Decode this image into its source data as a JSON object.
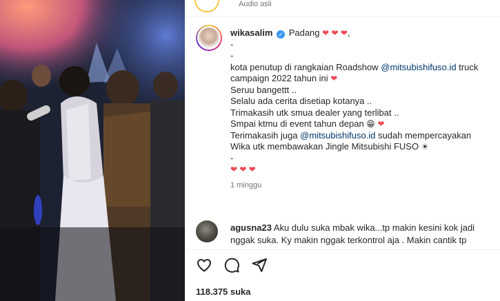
{
  "media": {
    "description_icon": "video-frame"
  },
  "audio": {
    "label": "Audio asli"
  },
  "post": {
    "username": "wikasalim",
    "location": "Padang",
    "caption_lines": [
      {
        "parts": [
          {
            "t": "-"
          }
        ]
      },
      {
        "parts": [
          {
            "t": "-"
          }
        ]
      },
      {
        "parts": [
          {
            "t": "kota penutup di rangkaian Roadshow "
          },
          {
            "t": "@mitsubishifuso.id",
            "mention": true
          },
          {
            "t": " truck"
          }
        ]
      },
      {
        "parts": [
          {
            "t": "campaign 2022 tahun ini "
          },
          {
            "t": "❤",
            "heart": true
          }
        ]
      },
      {
        "parts": [
          {
            "t": "Seruu bangettt .."
          }
        ]
      },
      {
        "parts": [
          {
            "t": "Selalu ada cerita disetiap kotanya .."
          }
        ]
      },
      {
        "parts": [
          {
            "t": "Trimakasih utk smua dealer yang terlibat .."
          }
        ]
      },
      {
        "parts": [
          {
            "t": "Smpai ktmu di event tahun depan "
          },
          {
            "t": "😁",
            "emoji": true
          },
          {
            "t": " "
          },
          {
            "t": "❤",
            "heart": true
          }
        ]
      },
      {
        "parts": [
          {
            "t": "Terimakasih juga "
          },
          {
            "t": "@mitsubishifuso.id",
            "mention": true
          },
          {
            "t": " sudah mempercayakan"
          }
        ]
      },
      {
        "parts": [
          {
            "t": "Wika utk membawakan Jingle Mitsubishi FUSO "
          },
          {
            "t": "☀",
            "emoji": true
          }
        ]
      },
      {
        "parts": [
          {
            "t": "-"
          }
        ]
      },
      {
        "parts": [
          {
            "t": "❤ ❤ ❤",
            "heart": true
          }
        ]
      }
    ],
    "time_ago": "1 minggu"
  },
  "comment": {
    "username": "agusna23",
    "line1": " Aku dulu suka mbak wika...tp makin kesini kok jadi",
    "line2": "nggak suka. Ky makin nggak terkontrol aja . Makin cantik tp"
  },
  "actions": {
    "like_icon": "heart-outline-icon",
    "comment_icon": "comment-bubble-icon",
    "share_icon": "paper-plane-icon"
  },
  "likes": {
    "label": "118.375 suka"
  }
}
